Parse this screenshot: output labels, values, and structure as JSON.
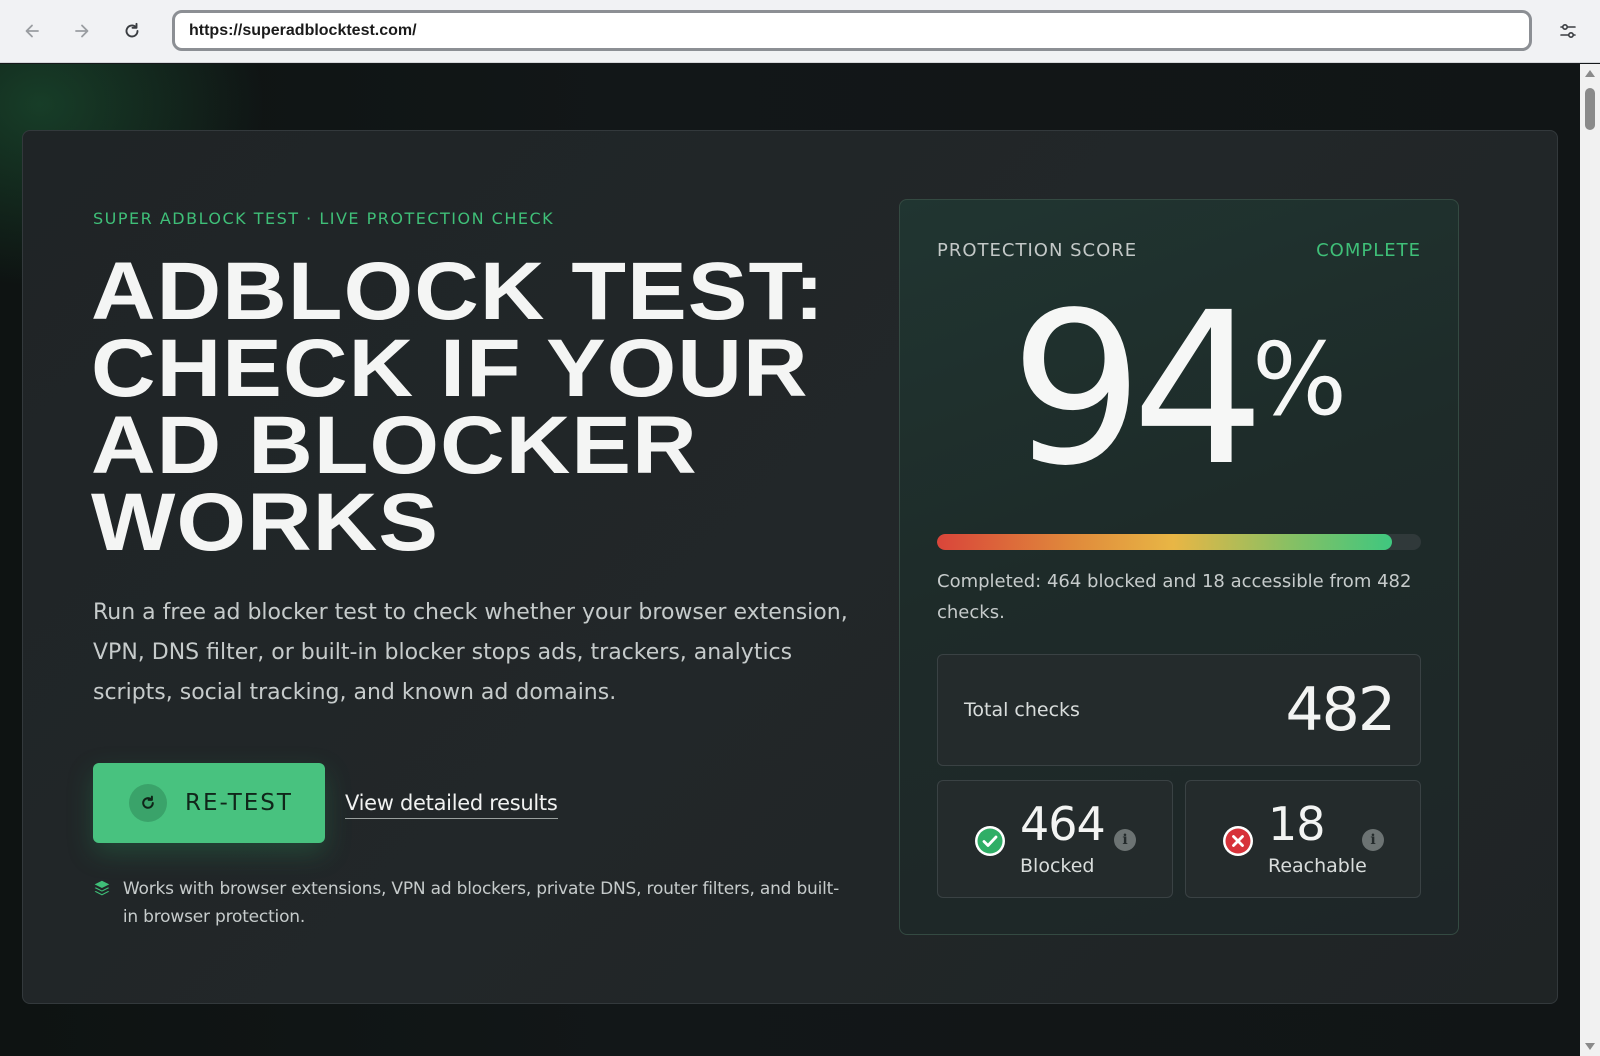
{
  "browser": {
    "url": "https://superadblocktest.com/",
    "back_icon": "arrow-left-icon",
    "forward_icon": "arrow-right-icon",
    "reload_icon": "reload-icon",
    "settings_icon": "tune-icon"
  },
  "hero": {
    "eyebrow": "SUPER ADBLOCK TEST · LIVE PROTECTION CHECK",
    "headline_lines": [
      "ADBLOCK TEST:",
      "CHECK IF YOUR",
      "AD BLOCKER",
      "WORKS"
    ],
    "lede": "Run a free ad blocker test to check whether your browser extension, VPN, DNS filter, or built-in blocker stops ads, trackers, analytics scripts, social tracking, and known ad domains.",
    "retest_label": "RE-TEST",
    "detail_link": "View detailed results",
    "works_text": "Works with browser extensions, VPN ad blockers, private DNS, router filters, and built-in browser protection."
  },
  "score": {
    "label": "PROTECTION SCORE",
    "status": "COMPLETE",
    "value": "94",
    "unit": "%",
    "progress": 0.94,
    "summary": "Completed: 464 blocked and 18 accessible from 482 checks.",
    "total_label": "Total checks",
    "total_value": "482",
    "blocked_value": "464",
    "blocked_label": "Blocked",
    "reachable_value": "18",
    "reachable_label": "Reachable"
  },
  "colors": {
    "accent_green": "#48c27f",
    "status_green": "#3fbf78",
    "blocked_icon": "#2fae66",
    "reachable_icon": "#d7323a",
    "card_bg": "#222729"
  }
}
